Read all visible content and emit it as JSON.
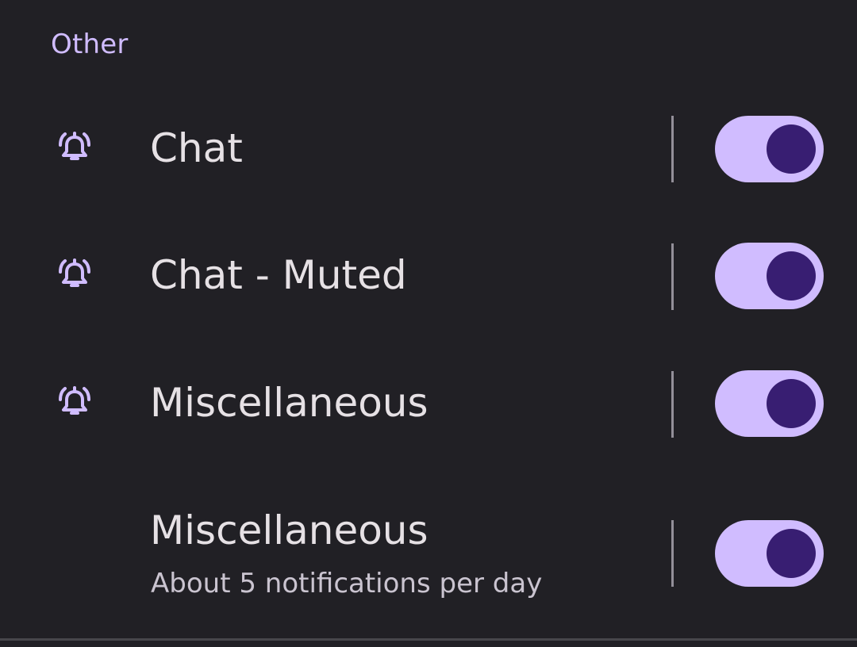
{
  "section": {
    "header": "Other"
  },
  "channels": [
    {
      "title": "Chat",
      "subtitle": "",
      "icon": "alarm-bell-icon",
      "enabled": true
    },
    {
      "title": "Chat - Muted",
      "subtitle": "",
      "icon": "alarm-bell-icon",
      "enabled": true
    },
    {
      "title": "Miscellaneous",
      "subtitle": "",
      "icon": "alarm-bell-icon",
      "enabled": true
    },
    {
      "title": "Miscellaneous",
      "subtitle": "About 5 notifications per day",
      "icon": "",
      "enabled": true
    }
  ],
  "colors": {
    "background": "#212025",
    "accent": "#d0bcff",
    "switch_thumb": "#381e72",
    "title_text": "#e6e1e5",
    "subtitle_text": "#cac4d0",
    "divider": "#938f99"
  }
}
